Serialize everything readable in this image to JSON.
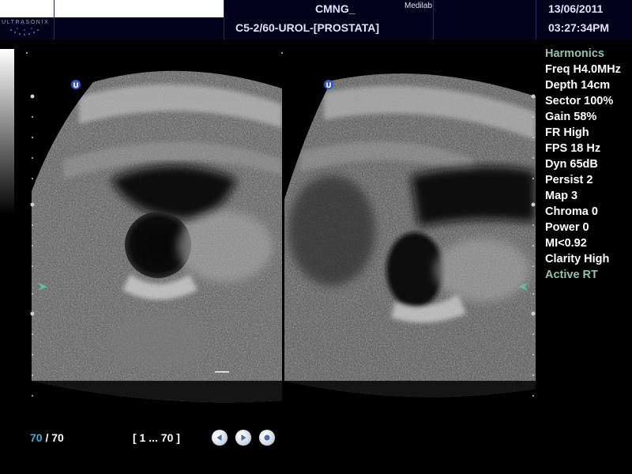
{
  "header": {
    "logo_text": "ULTRASONIX",
    "site": "CMNG_",
    "vendor": "Medilab",
    "preset": "C5-2/60-UROL-[PROSTATA]",
    "date": "13/06/2011",
    "time": "03:27:34PM"
  },
  "params": [
    {
      "label": "Harmonics",
      "color": "#8fc4ae"
    },
    {
      "label": "Freq H4.0MHz"
    },
    {
      "label": "Depth 14cm"
    },
    {
      "label": "Sector 100%"
    },
    {
      "label": "Gain 58%"
    },
    {
      "label": "FR High"
    },
    {
      "label": "FPS 18 Hz"
    },
    {
      "label": "Dyn 65dB"
    },
    {
      "label": "Persist 2"
    },
    {
      "label": "Map 3"
    },
    {
      "label": "Chroma 0"
    },
    {
      "label": "Power 0"
    },
    {
      "label": "MI<0.92"
    },
    {
      "label": "Clarity High"
    },
    {
      "label": "Active RT",
      "color": "#8fc4ae"
    }
  ],
  "image": {
    "orientation_marker_left": "U",
    "orientation_marker_right": "U",
    "left_panel_depth_cm": 14,
    "right_panel_depth_cm": 14
  },
  "cine": {
    "current": "70",
    "separator": " / ",
    "total": "70",
    "range": "[ 1 ... 70 ]",
    "buttons": [
      "previous-icon",
      "play-icon",
      "stop-icon"
    ]
  }
}
